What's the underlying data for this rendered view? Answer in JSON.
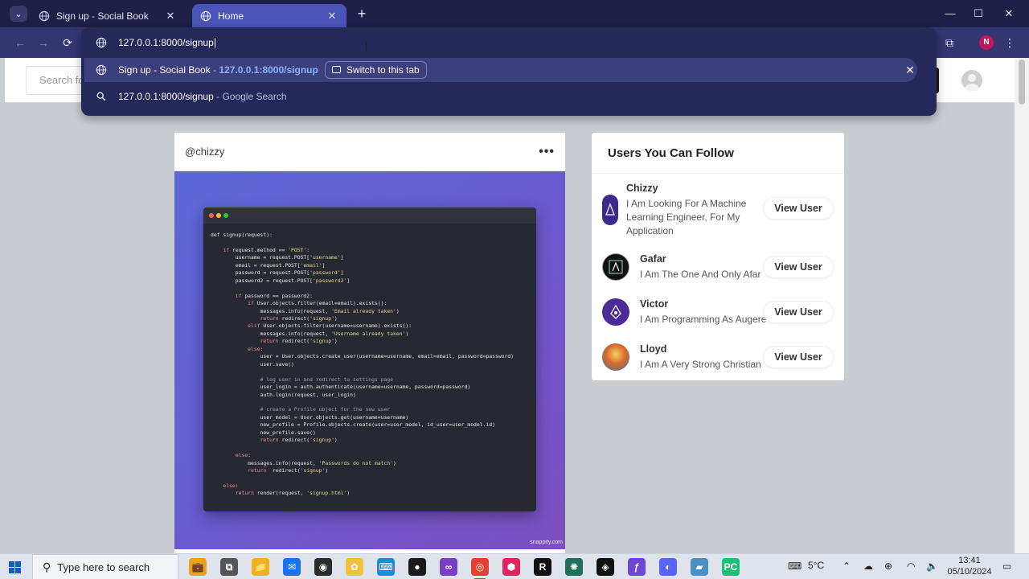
{
  "browser": {
    "tabs": [
      {
        "title": "Sign up - Social Book",
        "active": false
      },
      {
        "title": "Home",
        "active": true
      }
    ],
    "new_tab_symbol": "+",
    "window_controls": {
      "minimize": "—",
      "maximize": "☐",
      "close": "✕"
    },
    "toolbar": {
      "back": "←",
      "forward": "→",
      "reload": "⟳"
    },
    "profile_initial": "N",
    "colors": {
      "frame": "#1f1f47",
      "toolbar": "#353572",
      "active_tab": "#4a55b8",
      "omnibox": "#26285a",
      "link_blue": "#8ab4f8"
    }
  },
  "omnibox": {
    "input_value": "127.0.0.1:8000/signup",
    "suggestions": [
      {
        "icon": "globe-icon",
        "title": "Sign up - Social Book",
        "separator": " - ",
        "url": "127.0.0.1:8000/signup",
        "action_label": "Switch to this tab",
        "remove_symbol": "✕"
      },
      {
        "icon": "search-icon",
        "query": "127.0.0.1:8000/signup",
        "separator": " - ",
        "provider": "Google Search"
      }
    ]
  },
  "page": {
    "search_placeholder": "Search fo",
    "post": {
      "username": "@chizzy",
      "more_symbol": "•••",
      "watermark": "snappify.com",
      "code_lines": [
        [
          [
            "",
            "def signup(request):"
          ]
        ],
        [
          [
            "",
            " "
          ]
        ],
        [
          [
            "",
            "    "
          ],
          [
            "kw",
            "if"
          ],
          [
            "",
            " request.method == "
          ],
          [
            "st",
            "'POST'"
          ],
          [
            "",
            ":"
          ]
        ],
        [
          [
            "",
            "        username = request.POST["
          ],
          [
            "st",
            "'username'"
          ],
          [
            "",
            "]"
          ]
        ],
        [
          [
            "",
            "        email = request.POST["
          ],
          [
            "st",
            "'email'"
          ],
          [
            "",
            "]"
          ]
        ],
        [
          [
            "",
            "        password = request.POST["
          ],
          [
            "st",
            "'password'"
          ],
          [
            "",
            "]"
          ]
        ],
        [
          [
            "",
            "        password2 = request.POST["
          ],
          [
            "st",
            "'password2'"
          ],
          [
            "",
            "]"
          ]
        ],
        [
          [
            "",
            " "
          ]
        ],
        [
          [
            "",
            "        "
          ],
          [
            "kw",
            "if"
          ],
          [
            "",
            " password == password2:"
          ]
        ],
        [
          [
            "",
            "            "
          ],
          [
            "kw",
            "if"
          ],
          [
            "",
            " User.objects.filter(email=email).exists():"
          ]
        ],
        [
          [
            "",
            "                messages.info(request, "
          ],
          [
            "st",
            "'Email already taken'"
          ],
          [
            "",
            ")"
          ]
        ],
        [
          [
            "",
            "                "
          ],
          [
            "kw",
            "return"
          ],
          [
            "",
            " redirect("
          ],
          [
            "st",
            "'signup'"
          ],
          [
            "",
            ")"
          ]
        ],
        [
          [
            "",
            "            "
          ],
          [
            "kw",
            "elif"
          ],
          [
            "",
            " User.objects.filter(username=username).exists():"
          ]
        ],
        [
          [
            "",
            "                messages.info(request, "
          ],
          [
            "st",
            "'Username already taken'"
          ],
          [
            "",
            ")"
          ]
        ],
        [
          [
            "",
            "                "
          ],
          [
            "kw",
            "return"
          ],
          [
            "",
            " redirect("
          ],
          [
            "st",
            "'signup'"
          ],
          [
            "",
            ")"
          ]
        ],
        [
          [
            "",
            "            "
          ],
          [
            "kw",
            "else"
          ],
          [
            "",
            ":"
          ]
        ],
        [
          [
            "",
            "                user = User.objects.create_user(username=username, email=email, password=password)"
          ]
        ],
        [
          [
            "",
            "                user.save()"
          ]
        ],
        [
          [
            "",
            " "
          ]
        ],
        [
          [
            "",
            "                "
          ],
          [
            "cm",
            "# log user in and redirect to settings page"
          ]
        ],
        [
          [
            "",
            "                user_login = auth.authenticate(username=username, password=password)"
          ]
        ],
        [
          [
            "",
            "                auth.login(request, user_login)"
          ]
        ],
        [
          [
            "",
            " "
          ]
        ],
        [
          [
            "",
            "                "
          ],
          [
            "cm",
            "# create a Profile object for the new user"
          ]
        ],
        [
          [
            "",
            "                user_model = User.objects.get(username=username)"
          ]
        ],
        [
          [
            "",
            "                new_profile = Profile.objects.create(user=user_model, id_user=user_model.id)"
          ]
        ],
        [
          [
            "",
            "                new_profile.save()"
          ]
        ],
        [
          [
            "",
            "                "
          ],
          [
            "kw",
            "return"
          ],
          [
            "",
            " redirect("
          ],
          [
            "st",
            "'signup'"
          ],
          [
            "",
            ")"
          ]
        ],
        [
          [
            "",
            " "
          ]
        ],
        [
          [
            "",
            "        "
          ],
          [
            "kw",
            "else"
          ],
          [
            "",
            ":"
          ]
        ],
        [
          [
            "",
            "            messages.info(request, "
          ],
          [
            "st",
            "'Passwords do not match'"
          ],
          [
            "",
            ")"
          ]
        ],
        [
          [
            "",
            "            "
          ],
          [
            "kw",
            "return"
          ],
          [
            "",
            "  redirect("
          ],
          [
            "st",
            "'signup'"
          ],
          [
            "",
            ")"
          ]
        ],
        [
          [
            "",
            " "
          ]
        ],
        [
          [
            "",
            "    "
          ],
          [
            "kw",
            "else"
          ],
          [
            "",
            ":"
          ]
        ],
        [
          [
            "",
            "        "
          ],
          [
            "kw",
            "return"
          ],
          [
            "",
            " render(request, "
          ],
          [
            "st",
            "'signup.html'"
          ],
          [
            "",
            ")"
          ]
        ]
      ]
    },
    "follow": {
      "title": "Users You Can Follow",
      "button_label": "View User",
      "users": [
        {
          "name": "Chizzy",
          "bio": "I Am Looking For A Machine Learning Engineer, For My Application",
          "avatar_color": "#3b2a8c"
        },
        {
          "name": "Gafar",
          "bio": "I Am The One And Only Afar",
          "avatar_color": "#111111"
        },
        {
          "name": "Victor",
          "bio": "I Am Programming As Augere",
          "avatar_color": "#4b2a9a"
        },
        {
          "name": "Lloyd",
          "bio": "I Am A Very Strong Christian",
          "avatar_color": "#c25a1e"
        }
      ]
    }
  },
  "taskbar": {
    "search_placeholder": "Type here to search",
    "temperature": "5°C",
    "time": "13:41",
    "date": "05/10/2024",
    "apps": [
      {
        "icon": "briefcase-icon",
        "label": "💼",
        "color": "#e8a21b"
      },
      {
        "icon": "task-view-icon",
        "label": "⧉",
        "color": "#555555"
      },
      {
        "icon": "file-explorer-icon",
        "label": "📁",
        "color": "#f2b01e"
      },
      {
        "icon": "mail-icon",
        "label": "✉",
        "color": "#1a73e8"
      },
      {
        "icon": "davinci-icon",
        "label": "◉",
        "color": "#2b2b2b"
      },
      {
        "icon": "photo-icon",
        "label": "✿",
        "color": "#f0c23b"
      },
      {
        "icon": "vscode-icon",
        "label": "⌨",
        "color": "#1f8ad6"
      },
      {
        "icon": "github-icon",
        "label": "●",
        "color": "#1b1b1b"
      },
      {
        "icon": "visual-studio-icon",
        "label": "∞",
        "color": "#7b3fc4"
      },
      {
        "icon": "chrome-icon",
        "label": "◎",
        "color": "#e34133"
      },
      {
        "icon": "cube-app-icon",
        "label": "⬢",
        "color": "#e0245e"
      },
      {
        "icon": "r-app-icon",
        "label": "R",
        "color": "#111111"
      },
      {
        "icon": "openai-icon",
        "label": "✺",
        "color": "#1f6f5a"
      },
      {
        "icon": "capcut-icon",
        "label": "◈",
        "color": "#111111"
      },
      {
        "icon": "fig-icon",
        "label": "ƒ",
        "color": "#6e47d4"
      },
      {
        "icon": "discord-icon",
        "label": "◐",
        "color": "#5865f2"
      },
      {
        "icon": "app-icon",
        "label": "▰",
        "color": "#4a90c2"
      },
      {
        "icon": "pycharm-icon",
        "label": "PC",
        "color": "#1cbf73"
      }
    ],
    "tray": [
      {
        "icon": "keyboard-icon",
        "label": "⌨"
      },
      {
        "icon": "chevron-up-icon",
        "label": "⌃"
      },
      {
        "icon": "cloud-icon",
        "label": "☁"
      },
      {
        "icon": "language-icon",
        "label": "⊕"
      },
      {
        "icon": "wifi-icon",
        "label": "◠"
      },
      {
        "icon": "volume-icon",
        "label": "🔈"
      },
      {
        "icon": "notification-icon",
        "label": "▭"
      }
    ]
  }
}
